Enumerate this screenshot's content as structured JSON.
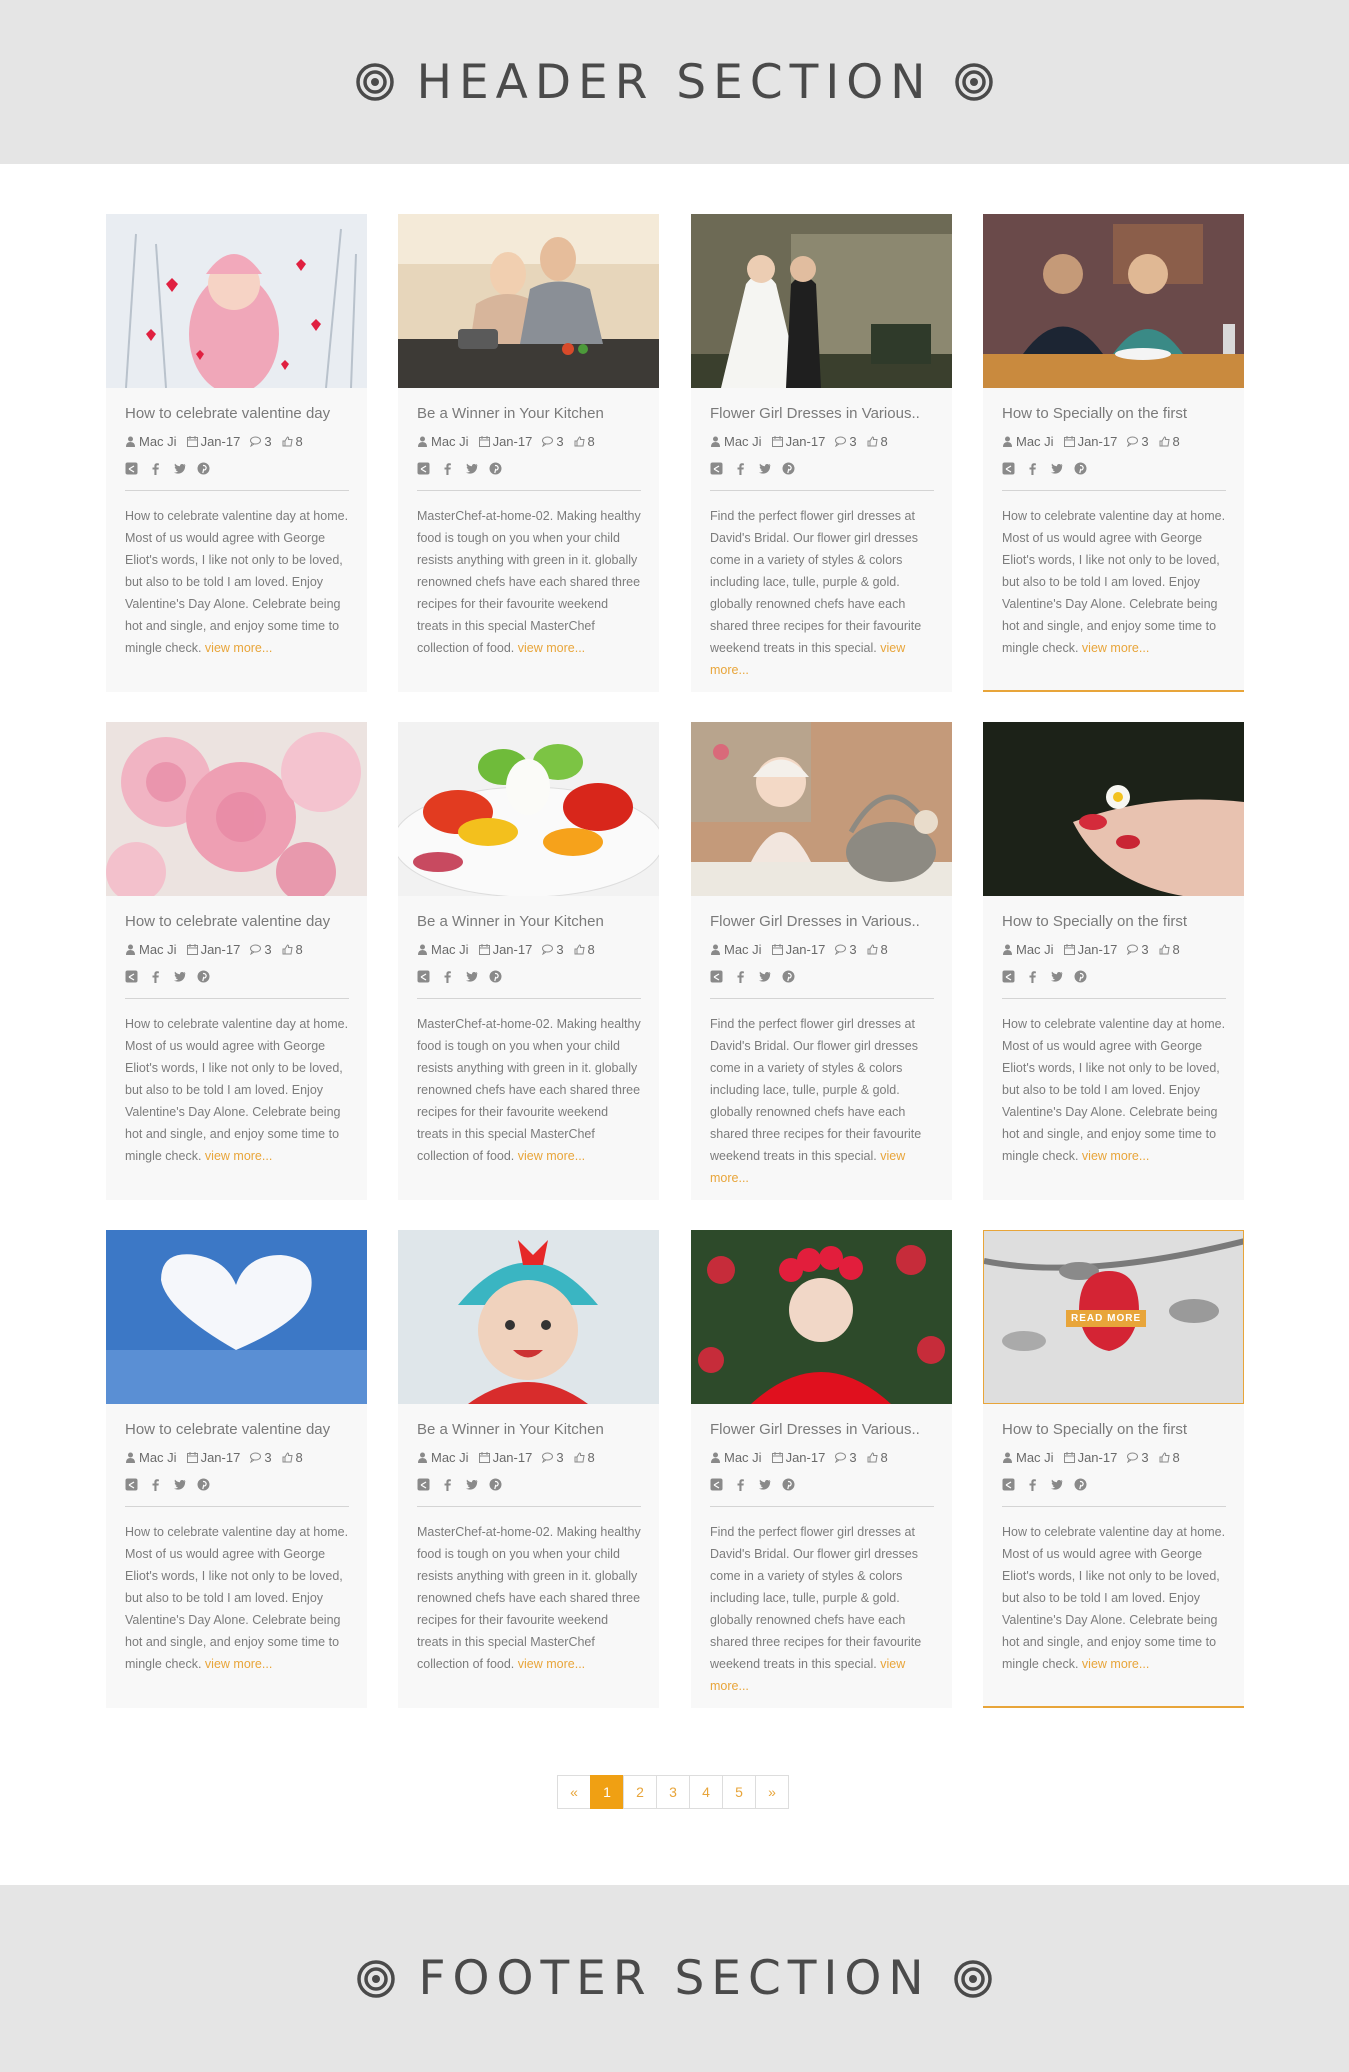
{
  "header": {
    "title": "HEADER SECTION"
  },
  "footer": {
    "title": "FOOTER SECTION"
  },
  "colors": {
    "accent": "#e8a53a",
    "band": "#e5e5e5",
    "card": "#f8f8f8"
  },
  "read_more_label": "READ MORE",
  "more_label": "view more...",
  "meta": {
    "author": "Mac Ji",
    "date": "Jan-17",
    "comments": "3",
    "likes": "8"
  },
  "social_icons": [
    "share-icon",
    "facebook-icon",
    "twitter-icon",
    "pinterest-icon"
  ],
  "cards": [
    {
      "title": "How to celebrate valentine day",
      "excerpt": "How to celebrate valentine day at home. Most of us would agree with George Eliot's words, I like not only to be loved, but also to be told I am loved. Enjoy Valentine's Day Alone. Celebrate being hot and single, and enjoy some time to mingle check.",
      "image": "woman-snow-hearts"
    },
    {
      "title": "Be a Winner in Your Kitchen",
      "excerpt": "MasterChef-at-home-02. Making healthy food is tough on you when your child resists anything with green in it. globally renowned chefs have each shared three recipes for their favourite weekend treats in this special MasterChef collection of food.",
      "image": "couple-cooking"
    },
    {
      "title": "Flower Girl Dresses in Various..",
      "excerpt": "Find the perfect flower girl dresses at David's Bridal. Our flower girl dresses come in a variety of styles & colors including lace, tulle, purple & gold. globally renowned chefs have each shared three recipes for their favourite weekend treats in this special.",
      "image": "wedding-couple"
    },
    {
      "title": "How to Specially on the first",
      "excerpt": "How to celebrate valentine day at home. Most of us would agree with George Eliot's words, I like not only to be loved, but also to be told I am loved. Enjoy Valentine's Day Alone. Celebrate being hot and single, and enjoy some time to mingle check.",
      "image": "couple-dinner"
    },
    {
      "title": "How to celebrate valentine day",
      "excerpt": "How to celebrate valentine day at home. Most of us would agree with George Eliot's words, I like not only to be loved, but also to be told I am loved. Enjoy Valentine's Day Alone. Celebrate being hot and single, and enjoy some time to mingle check.",
      "image": "pink-carnations"
    },
    {
      "title": "Be a Winner in Your Kitchen",
      "excerpt": "MasterChef-at-home-02. Making healthy food is tough on you when your child resists anything with green in it. globally renowned chefs have each shared three recipes for their favourite weekend treats in this special MasterChef collection of food.",
      "image": "salad"
    },
    {
      "title": "Flower Girl Dresses in Various..",
      "excerpt": "Find the perfect flower girl dresses at David's Bridal. Our flower girl dresses come in a variety of styles & colors including lace, tulle, purple & gold. globally renowned chefs have each shared three recipes for their favourite weekend treats in this special.",
      "image": "baby-basket"
    },
    {
      "title": "How to Specially on the first",
      "excerpt": "How to celebrate valentine day at home. Most of us would agree with George Eliot's words, I like not only to be loved, but also to be told I am loved. Enjoy Valentine's Day Alone. Celebrate being hot and single, and enjoy some time to mingle check.",
      "image": "daisy-fingers"
    },
    {
      "title": "How to celebrate valentine day",
      "excerpt": "How to celebrate valentine day at home. Most of us would agree with George Eliot's words, I like not only to be loved, but also to be told I am loved. Enjoy Valentine's Day Alone. Celebrate being hot and single, and enjoy some time to mingle check.",
      "image": "cloud-heart"
    },
    {
      "title": "Be a Winner in Your Kitchen",
      "excerpt": "MasterChef-at-home-02. Making healthy food is tough on you when your child resists anything with green in it. globally renowned chefs have each shared three recipes for their favourite weekend treats in this special MasterChef collection of food.",
      "image": "baby-knit-hat"
    },
    {
      "title": "Flower Girl Dresses in Various..",
      "excerpt": "Find the perfect flower girl dresses at David's Bridal. Our flower girl dresses come in a variety of styles & colors including lace, tulle, purple & gold. globally renowned chefs have each shared three recipes for their favourite weekend treats in this special.",
      "image": "girl-red-roses"
    },
    {
      "title": "How to Specially on the first",
      "excerpt": "How to celebrate valentine day at home. Most of us would agree with George Eliot's words, I like not only to be loved, but also to be told I am loved. Enjoy Valentine's Day Alone. Celebrate being hot and single, and enjoy some time to mingle check.",
      "image": "red-apple"
    }
  ],
  "pagination": {
    "prev": "«",
    "pages": [
      "1",
      "2",
      "3",
      "4",
      "5"
    ],
    "next": "»",
    "current": "1"
  }
}
